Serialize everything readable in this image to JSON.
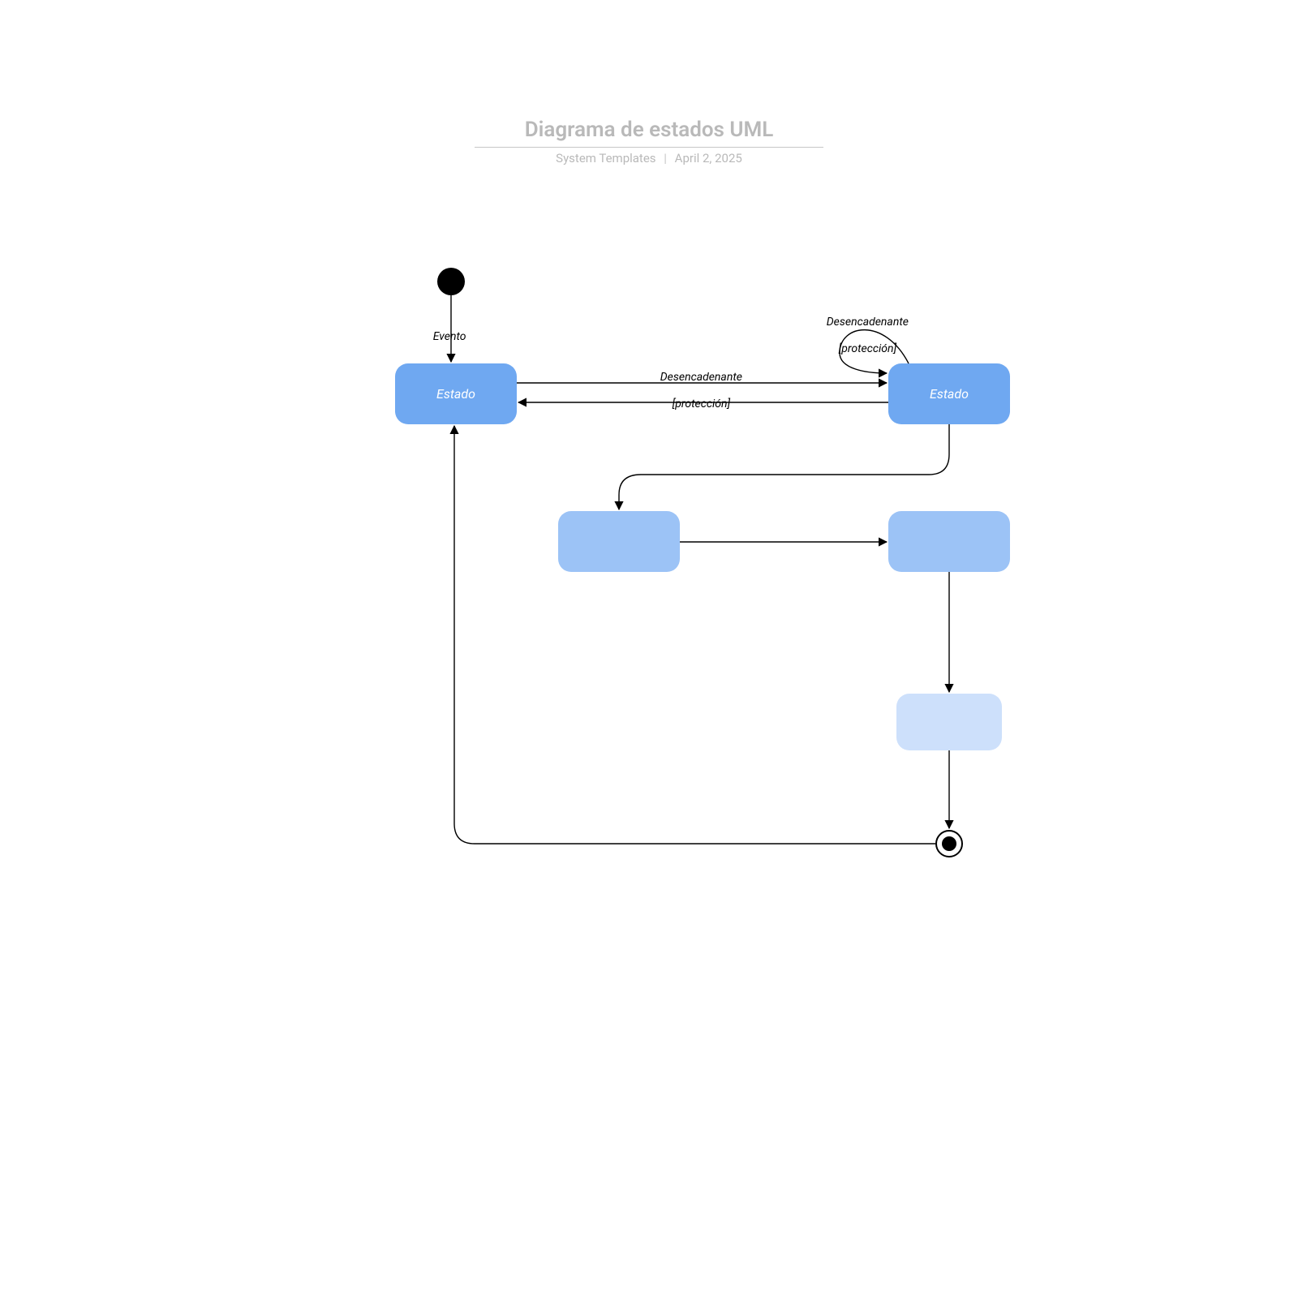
{
  "header": {
    "title": "Diagrama de estados UML",
    "author": "System Templates",
    "date": "April 2, 2025"
  },
  "labels": {
    "evento": "Evento",
    "trigger_label": "Desencadenante",
    "guard_label": "[protección]"
  },
  "states": {
    "s1": "Estado",
    "s2": "Estado",
    "s3": "",
    "s4": "",
    "s5": ""
  },
  "diagram": {
    "type": "uml_state",
    "initial": "initial",
    "final": "final",
    "nodes": [
      {
        "id": "initial",
        "kind": "initial"
      },
      {
        "id": "s1",
        "kind": "state",
        "label": "Estado",
        "shade": "dark"
      },
      {
        "id": "s2",
        "kind": "state",
        "label": "Estado",
        "shade": "dark"
      },
      {
        "id": "s3",
        "kind": "state",
        "label": "",
        "shade": "mid"
      },
      {
        "id": "s4",
        "kind": "state",
        "label": "",
        "shade": "mid"
      },
      {
        "id": "s5",
        "kind": "state",
        "label": "",
        "shade": "light"
      },
      {
        "id": "final",
        "kind": "final"
      }
    ],
    "edges": [
      {
        "from": "initial",
        "to": "s1",
        "label": "Evento"
      },
      {
        "from": "s1",
        "to": "s2",
        "label": "Desencadenante [protección]"
      },
      {
        "from": "s2",
        "to": "s1",
        "label": ""
      },
      {
        "from": "s2",
        "to": "s2",
        "label": "Desencadenante [protección]",
        "self": true
      },
      {
        "from": "s2",
        "to": "s3",
        "label": ""
      },
      {
        "from": "s3",
        "to": "s4",
        "label": ""
      },
      {
        "from": "s4",
        "to": "s5",
        "label": ""
      },
      {
        "from": "s5",
        "to": "final",
        "label": ""
      },
      {
        "from": "final",
        "to": "s1",
        "label": ""
      }
    ]
  }
}
